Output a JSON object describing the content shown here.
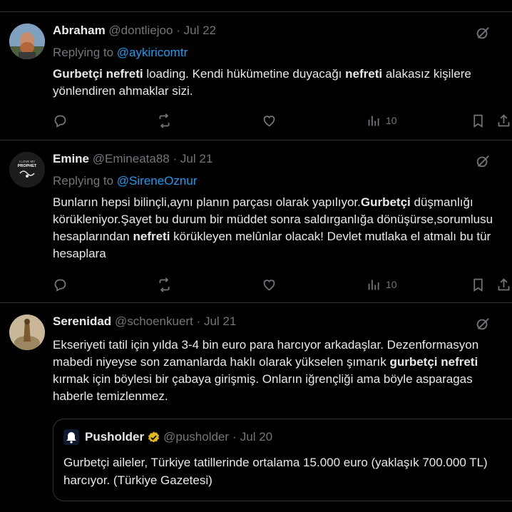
{
  "tweets": [
    {
      "name": "Abraham",
      "handle": "@dontliejoo",
      "sep": "·",
      "date": "Jul 22",
      "replying_prefix": "Replying to",
      "replying_handle": "@aykiricomtr",
      "body": [
        {
          "t": "Gurbetçi nefreti",
          "b": true
        },
        {
          "t": " loading. Kendi hükümetine duyacağı ",
          "b": false
        },
        {
          "t": "nefreti",
          "b": true
        },
        {
          "t": " alakasız kişilere yönlendiren ahmaklar sizi.",
          "b": false
        }
      ],
      "views": "10"
    },
    {
      "name": "Emine",
      "handle": "@Emineata88",
      "sep": "·",
      "date": "Jul 21",
      "replying_prefix": "Replying to",
      "replying_handle": "@SireneOznur",
      "body": [
        {
          "t": "Bunların hepsi bilinçli,aynı planın parçası olarak yapılıyor.",
          "b": false
        },
        {
          "t": "Gurbetçi",
          "b": true
        },
        {
          "t": " düşmanlığı körükleniyor.Şayet bu durum bir müddet sonra saldırganlığa dönüşürse,sorumlusu hesaplarından ",
          "b": false
        },
        {
          "t": "nefreti",
          "b": true
        },
        {
          "t": " körükleyen melûnlar olacak! Devlet mutlaka el atmalı bu tür hesaplara",
          "b": false
        }
      ],
      "avatar_text_1": "I LOVE MY",
      "avatar_text_2": "PROPHET",
      "views": "10"
    },
    {
      "name": "Serenidad",
      "handle": "@schoenkuert",
      "sep": "·",
      "date": "Jul 21",
      "body": [
        {
          "t": "Ekseriyeti tatil için yılda 3-4 bin euro para harcıyor arkadaşlar. Dezenformasyon mabedi niyeyse son zamanlarda haklı olarak yükselen şımarık ",
          "b": false
        },
        {
          "t": "gurbetçi nefreti",
          "b": true
        },
        {
          "t": " kırmak için böylesi bir çabaya girişmiş. Onların iğrençliği ama böyle asparagas haberle temizlenmez.",
          "b": false
        }
      ],
      "quote": {
        "name": "Pusholder",
        "handle": "@pusholder",
        "sep": "·",
        "date": "Jul 20",
        "body": "Gurbetçi aileler, Türkiye tatillerinde ortalama 15.000 euro (yaklaşık 700.000 TL) harcıyor. (Türkiye Gazetesi)"
      }
    }
  ],
  "icons": {
    "reply": "reply-icon",
    "retweet": "retweet-icon",
    "like": "heart-icon",
    "views": "views-icon",
    "bookmark": "bookmark-icon",
    "share": "share-icon",
    "grok": "grok-icon",
    "verified": "verified-badge-icon"
  },
  "colors": {
    "accent": "#1d9bf0",
    "muted": "#71767b",
    "text": "#e7e9ea",
    "border": "#2f3336",
    "verified": "#e2b719"
  }
}
